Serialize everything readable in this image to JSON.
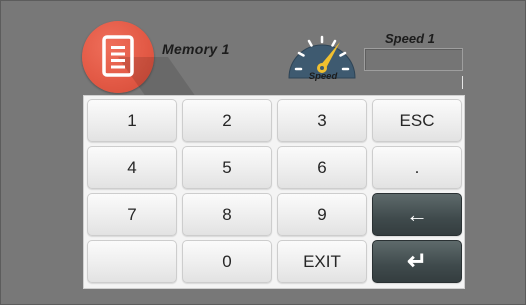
{
  "memory": {
    "label": "Memory 1",
    "icon": "document-icon",
    "accent": "#e35a46"
  },
  "speed": {
    "gauge_label": "Speed",
    "title": "Speed 1",
    "value": "",
    "icon": "speedometer-icon",
    "gauge_color": "#3e5a70",
    "needle_color": "#f0c030"
  },
  "keypad": {
    "keys": {
      "k1": "1",
      "k2": "2",
      "k3": "3",
      "esc": "ESC",
      "k4": "4",
      "k5": "5",
      "k6": "6",
      "dot": ".",
      "k7": "7",
      "k8": "8",
      "k9": "9",
      "backspace": "←",
      "blank": "",
      "k0": "0",
      "exit": "EXIT",
      "enter": "↵"
    },
    "dark_key_color": "#3f4a4c"
  }
}
